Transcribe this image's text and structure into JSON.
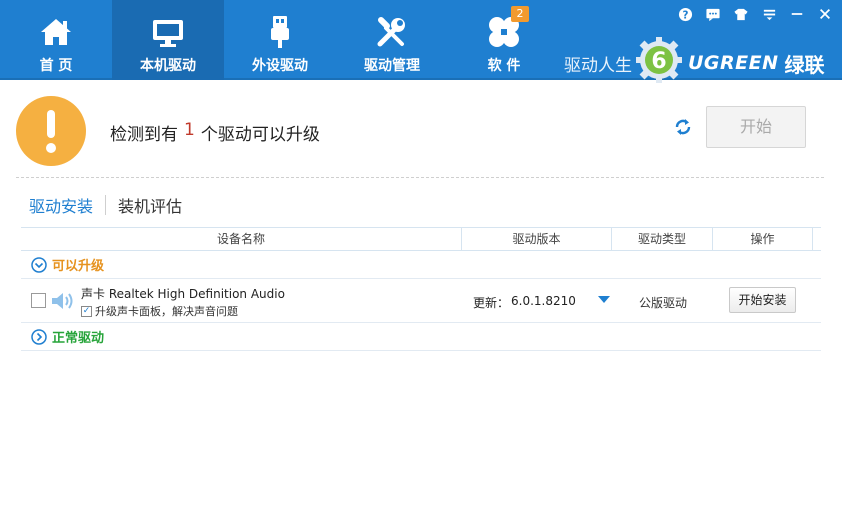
{
  "nav": {
    "items": [
      {
        "label": "首 页",
        "icon": "home-icon"
      },
      {
        "label": "本机驱动",
        "icon": "monitor-icon",
        "active": true
      },
      {
        "label": "外设驱动",
        "icon": "usb-icon"
      },
      {
        "label": "驱动管理",
        "icon": "tools-icon"
      },
      {
        "label": "软 件",
        "icon": "software-icon",
        "badge": "2"
      }
    ]
  },
  "window_controls": [
    "help-icon",
    "feedback-icon",
    "skin-icon",
    "menu-icon",
    "minimize-icon",
    "close-icon"
  ],
  "brand": {
    "slogan": "驱动人生",
    "logo_char": "6",
    "ugreen": "UGREEN",
    "lvlian": "绿联"
  },
  "status": {
    "prefix": "检测到有",
    "count": "1",
    "suffix": "个驱动可以升级",
    "start_label": "开始"
  },
  "tabs": [
    {
      "label": "驱动安装",
      "active": true
    },
    {
      "label": "装机评估"
    }
  ],
  "table": {
    "headers": [
      "设备名称",
      "驱动版本",
      "驱动类型",
      "操作"
    ],
    "upgradable_group": "可以升级",
    "normal_group": "正常驱动",
    "rows": [
      {
        "name": "声卡 Realtek High Definition Audio",
        "sub": "升级声卡面板，解决声音问题",
        "version_prefix": "更新：",
        "version": "6.0.1.8210",
        "type": "公版驱动",
        "action": "开始安装"
      }
    ]
  },
  "colors": {
    "topbar": "#1f7fd0",
    "active_nav": "#1a6bb2",
    "warning": "#f5b041",
    "upgrade_group": "#e6921e",
    "normal_group": "#27a43a",
    "count": "#c0392b"
  }
}
